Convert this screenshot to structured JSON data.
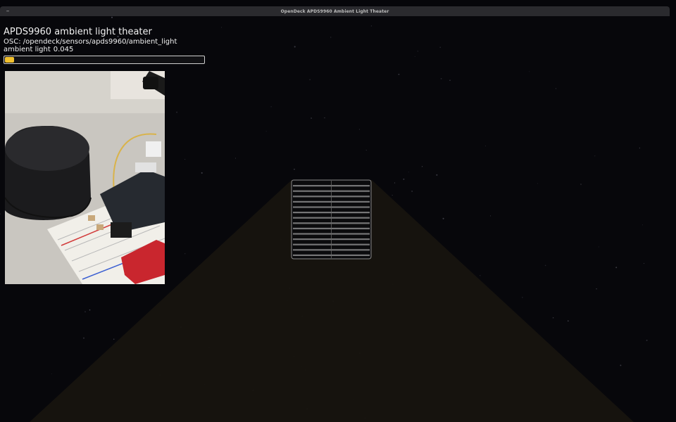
{
  "window": {
    "title": "OpenDeck APDS9960 Ambient Light Theater",
    "menu_glyph": "–"
  },
  "hud": {
    "title": "APDS9960 ambient light theater",
    "osc_label": "OSC: /opendeck/sensors/apds9960/ambient_light",
    "ambient_label": "ambient light",
    "ambient_value": "0.045"
  },
  "meter": {
    "level_fraction": 0.045,
    "fill_color": "#f2c12e"
  },
  "camera": {
    "content": "webcam feed of dark cylindrical sensor on breadboard with red APDS9960 board"
  },
  "scene": {
    "background_color": "#07070b",
    "light_cone_color": "#17140f",
    "lamp_panel_color": "#9a9a9a"
  }
}
